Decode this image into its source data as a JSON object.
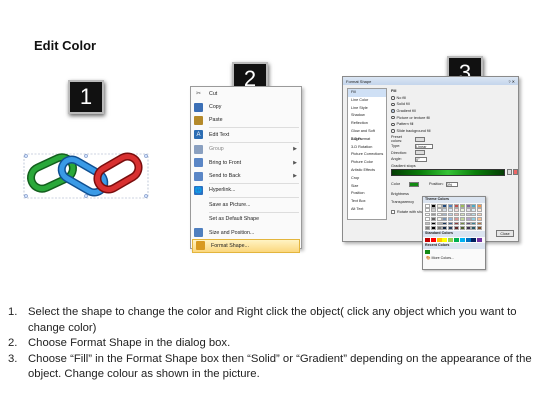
{
  "title": "Edit Color",
  "steps": [
    "1",
    "2",
    "3"
  ],
  "chain_colors": [
    "#1c8e2a",
    "#1f7fd0",
    "#c21b1b"
  ],
  "context_menu": {
    "items": [
      {
        "label": "Cut",
        "icon": "scissors-icon",
        "color": "#6b6b6b"
      },
      {
        "label": "Copy",
        "icon": "copy-icon",
        "color": "#3b6fb6"
      },
      {
        "label": "Paste",
        "icon": "paste-icon",
        "color": "#b58a2a"
      },
      {
        "label": "Edit Text",
        "icon": "edit-text-icon",
        "color": "#2d6db3"
      },
      {
        "label": "Group",
        "icon": "group-icon",
        "color": "#8aa0c0",
        "submenu": true,
        "disabled": true
      },
      {
        "label": "Bring to Front",
        "icon": "bring-front-icon",
        "color": "#5a86c6",
        "submenu": true
      },
      {
        "label": "Send to Back",
        "icon": "send-back-icon",
        "color": "#5a86c6",
        "submenu": true
      },
      {
        "label": "Hyperlink...",
        "icon": "hyperlink-icon",
        "color": "#2c70c0"
      },
      {
        "label": "Save as Picture...",
        "icon": "",
        "color": ""
      },
      {
        "label": "Set as Default Shape",
        "icon": "",
        "color": ""
      },
      {
        "label": "Size and Position...",
        "icon": "size-icon",
        "color": "#4f7fbf"
      },
      {
        "label": "Format Shape...",
        "icon": "format-shape-icon",
        "color": "#d89a20",
        "highlighted": true
      }
    ]
  },
  "dialog": {
    "title": "Format Shape",
    "categories": [
      "Fill",
      "Line Color",
      "Line Style",
      "Shadow",
      "Reflection",
      "Glow and Soft Edges",
      "3-D Format",
      "3-D Rotation",
      "Picture Corrections",
      "Picture Color",
      "Artistic Effects",
      "Crop",
      "Size",
      "Position",
      "Text Box",
      "Alt Text"
    ],
    "fill_heading": "Fill",
    "fill_options": [
      {
        "label": "No fill",
        "selected": false
      },
      {
        "label": "Solid fill",
        "selected": false
      },
      {
        "label": "Gradient fill",
        "selected": true
      },
      {
        "label": "Picture or texture fill",
        "selected": false
      },
      {
        "label": "Pattern fill",
        "selected": false
      },
      {
        "label": "Slide background fill",
        "selected": false
      }
    ],
    "fields": [
      {
        "label": "Preset colors:"
      },
      {
        "label": "Type:",
        "value": "Linear"
      },
      {
        "label": "Direction:"
      },
      {
        "label": "Angle:",
        "value": "0°"
      },
      {
        "label": "Gradient stops"
      }
    ],
    "lower_fields": [
      {
        "label": "Color",
        "extra": "Position:",
        "value": "0%"
      },
      {
        "label": "Brightness"
      },
      {
        "label": "Transparency"
      },
      {
        "label": "Rotate with shape"
      }
    ],
    "buttons": [
      "Close"
    ]
  },
  "picker": {
    "theme_label": "Theme Colors",
    "standard_label": "Standard Colors",
    "recent_label": "Recent Colors",
    "more_label": "More Colors...",
    "theme_top": [
      "#ffffff",
      "#000000",
      "#eeece1",
      "#1f497d",
      "#4f81bd",
      "#c0504d",
      "#9bbb59",
      "#8064a2",
      "#4bacc6",
      "#f79646"
    ],
    "standard": [
      "#c00000",
      "#ff0000",
      "#ffc000",
      "#ffff00",
      "#92d050",
      "#00b050",
      "#00b0f0",
      "#0070c0",
      "#002060",
      "#7030a0"
    ],
    "recent": [
      "#138a13"
    ]
  },
  "instructions": [
    {
      "num": "1.",
      "text": "Select the shape to change the color and Right click the object( click any object which you want to change color)"
    },
    {
      "num": "2.",
      "text": "Choose Format Shape in the dialog box."
    },
    {
      "num": "3.",
      "text": "Choose “Fill” in the Format Shape box then “Solid” or “Gradient” depending on the appearance of the object. Change colour as shown in the picture."
    }
  ]
}
